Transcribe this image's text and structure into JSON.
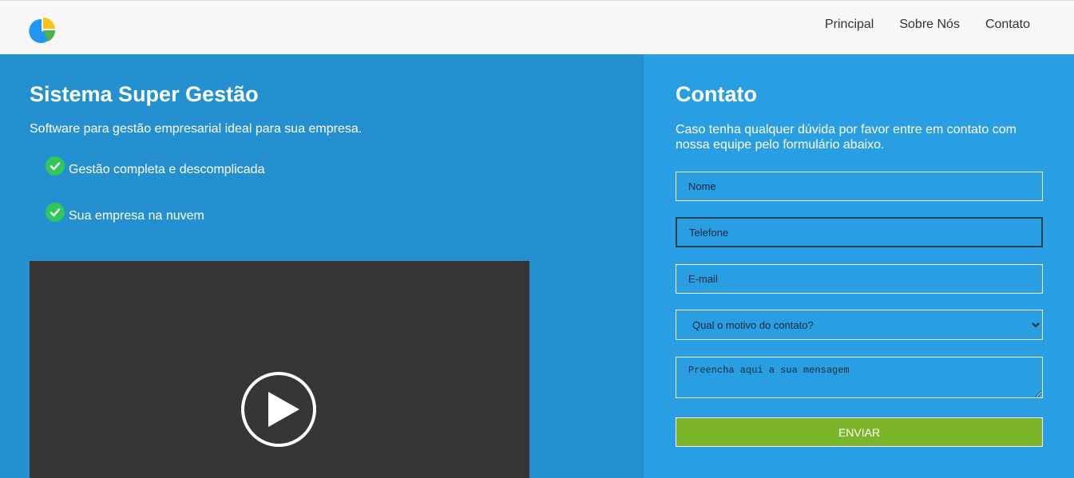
{
  "header": {
    "nav": [
      {
        "label": "Principal"
      },
      {
        "label": "Sobre Nós"
      },
      {
        "label": "Contato"
      }
    ]
  },
  "hero": {
    "title": "Sistema Super Gestão",
    "subtitle": "Software para gestão empresarial ideal para sua empresa.",
    "features": [
      {
        "label": "Gestão completa e descomplicada"
      },
      {
        "label": "Sua empresa na nuvem"
      }
    ]
  },
  "contact": {
    "title": "Contato",
    "description": "Caso tenha qualquer dúvida por favor entre em contato com nossa equipe pelo formulário abaixo.",
    "fields": {
      "name_placeholder": "Nome",
      "phone_placeholder": "Telefone",
      "email_placeholder": "E-mail",
      "reason_selected": "Qual o motivo do contato?",
      "message_placeholder": "Preencha aqui a sua mensagem"
    },
    "submit_label": "ENVIAR"
  },
  "colors": {
    "left_panel": "#2590d0",
    "right_panel": "#299ee2",
    "submit": "#7bb62a",
    "check": "#30c85a",
    "video_bg": "#363636"
  },
  "icons": [
    "pie-chart-logo-icon",
    "check-circle-icon",
    "play-icon"
  ]
}
